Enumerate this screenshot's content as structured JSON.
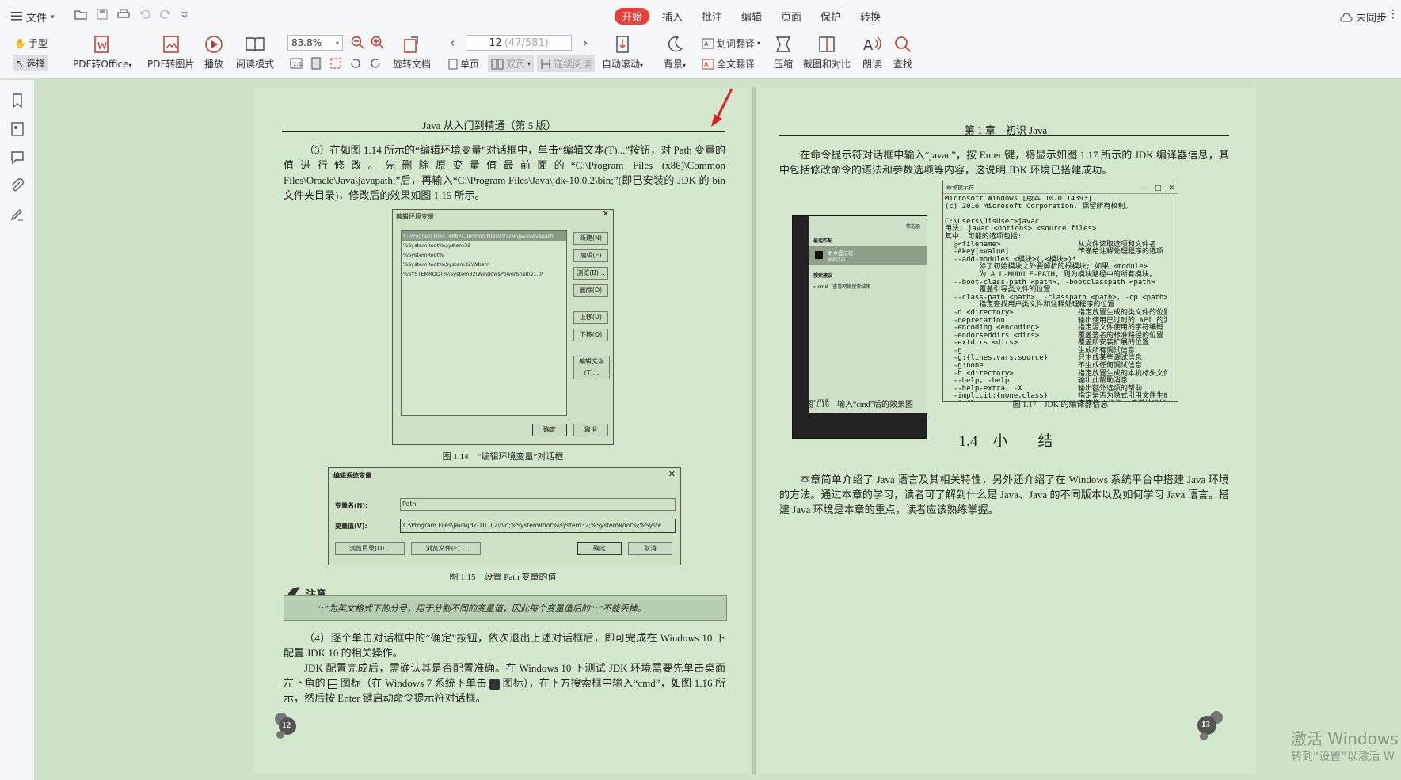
{
  "app": {
    "file_menu": "文件",
    "tabs": [
      "开始",
      "插入",
      "批注",
      "编辑",
      "页面",
      "保护",
      "转换"
    ],
    "active_tab": "开始",
    "sync_status": "未同步",
    "accent_color": "#e8413a"
  },
  "toolbar": {
    "hand_tool": "手型",
    "select_tool": "选择",
    "pdf_to_office": "PDF转Office",
    "pdf_to_image": "PDF转图片",
    "play": "播放",
    "read_mode": "阅读模式",
    "zoom_value": "83.8%",
    "rotate_doc": "旋转文档",
    "page_current": "12",
    "page_info": "(47/581)",
    "single_page": "单页",
    "double_page": "双页",
    "continuous_read": "连续阅读",
    "auto_scroll": "自动滚动",
    "background": "背景",
    "word_translate": "划词翻译",
    "full_translate": "全文翻译",
    "compress": "压缩",
    "screenshot_compare": "截图和对比",
    "read_aloud": "朗读",
    "find": "查找"
  },
  "left_page": {
    "header": "Java 从入门到精通（第 5 版）",
    "para1": "（3）在如图 1.14 所示的“编辑环境变量”对话框中，单击“编辑文本(T)...”按钮，对 Path 变量的值进行修改。先删除原变量值最前面的“C:\\Program Files (x86)\\Common Files\\Oracle\\Java\\javapath;”后，再输入“C:\\Program Files\\Java\\jdk-10.0.2\\bin;”(即已安装的 JDK 的 bin 文件夹目录)，修改后的效果如图 1.15 所示。",
    "fig114": {
      "title": "编辑环境变量",
      "items": [
        "C:\\Program Files (x86)\\Common Files\\Oracle\\Java\\javapath",
        "%SystemRoot%\\system32",
        "%SystemRoot%",
        "%SystemRoot%\\System32\\Wbem",
        "%SYSTEMROOT%\\System32\\WindowsPowerShell\\v1.0\\"
      ],
      "buttons": [
        "新建(N)",
        "编辑(E)",
        "浏览(B)...",
        "删除(D)",
        "上移(U)",
        "下移(O)",
        "编辑文本(T)..."
      ],
      "ok": "确定",
      "cancel": "取消",
      "caption": "图 1.14　“编辑环境变量”对话框"
    },
    "fig115": {
      "title": "编辑系统变量",
      "name_label": "变量名(N):",
      "name_value": "Path",
      "value_label": "变量值(V):",
      "value_value": "C:\\Program Files\\Java\\jdk-10.0.2\\bin;%SystemRoot%\\system32;%SystemRoot%;%Syste",
      "browse_dir": "浏览目录(D)...",
      "browse_file": "浏览文件(F)...",
      "ok": "确定",
      "cancel": "取消",
      "caption": "图 1.15　设置 Path 变量的值"
    },
    "note_title": "注意",
    "note_text": "“;”为英文格式下的分号，用于分割不同的变量值，因此每个变量值后的“;”不能丢掉。",
    "para4": "（4）逐个单击对话框中的“确定”按钮，依次退出上述对话框后，即可完成在 Windows 10 下配置 JDK 10 的相关操作。",
    "para5a": "JDK 配置完成后，需确认其是否配置准确。在 Windows 10 下测试 JDK 环境需要先单击桌面左下角的",
    "para5b": "图标（在 Windows 7 系统下单击",
    "para5c": "图标），在下方搜索框中输入“cmd”，如图 1.16 所示，然后按 Enter 键启动命令提示符对话框。",
    "page_number": "12"
  },
  "right_page": {
    "header": "第 1 章　初识 Java",
    "para1": "在命令提示符对话框中输入“javac”，按 Enter 键，将显示如图 1.17 所示的 JDK 编译器信息，其中包括修改命令的语法和参数选项等内容，这说明 JDK 环境已搭建成功。",
    "fig116": {
      "filter": "筛选器",
      "best_match": "最佳匹配",
      "app_name": "命令提示符",
      "app_type": "桌面应用",
      "search_suggest": "搜索建议",
      "suggest_item": "cmd - 查看网络搜索结果",
      "search_box": "cmd",
      "caption": "图 1.16　输入“cmd”后的效果图"
    },
    "fig117": {
      "title": "命令提示符",
      "terminal": "Microsoft Windows [版本 10.0.14393]\n(c) 2016 Microsoft Corporation. 保留所有权利。\n\nC:\\Users\\JisUser>javac\n用法: javac <options> <source files>\n其中, 可能的选项包括:\n  @<filename>                  从文件读取选项和文件名\n  -Akey[=value]                传递给注释处理程序的选项\n  --add-modules <模块>(,<模块>)*\n        除了初始模块之外要解析的根模块; 如果 <module>\n        为 ALL-MODULE-PATH, 则为模块路径中的所有模块。\n  --boot-class-path <path>, -bootclasspath <path>\n        覆盖引导类文件的位置\n  --class-path <path>, -classpath <path>, -cp <path>\n        指定查找用户类文件和注释处理程序的位置\n  -d <directory>               指定放置生成的类文件的位置\n  -deprecation                 输出使用已过时的 API 的源位置\n  -encoding <encoding>         指定源文件使用的字符编码\n  -endorseddirs <dirs>         覆盖签名的标准路径的位置\n  -extdirs <dirs>              覆盖所安装扩展的位置\n  -g                           生成所有调试信息\n  -g:{lines,vars,source}       只生成某些调试信息\n  -g:none                      不生成任何调试信息\n  -h <directory>               指定放置生成的本机标头文件的位置\n  --help, -help                输出此帮助消息\n  --help-extra, -X             输出额外选项的帮助\n  -implicit:{none,class}       指定是否为隐式引用文件生成类文件\n  -J<flag>                     直接将 <标记> 传递给运行时系统\n  --limit-modules <模块>(,<模块>)*\n        限制可观察模块的领域\n  --module <module-name>, -m <module-name>\n        只编译指定的模块, 请检查时间戳",
      "caption": "图 1.17　JDK 的编译器信息"
    },
    "section_title": "1.4　小　　结",
    "summary": "本章简单介绍了 Java 语言及其相关特性，另外还介绍了在 Windows 系统平台中搭建 Java 环境的方法。通过本章的学习，读者可了解到什么是 Java、Java 的不同版本以及如何学习 Java 语言。搭建 Java 环境是本章的重点，读者应该熟练掌握。",
    "page_number": "13"
  },
  "watermark": {
    "line1": "激活 Windows",
    "line2": "转到“设置”以激活 W"
  }
}
